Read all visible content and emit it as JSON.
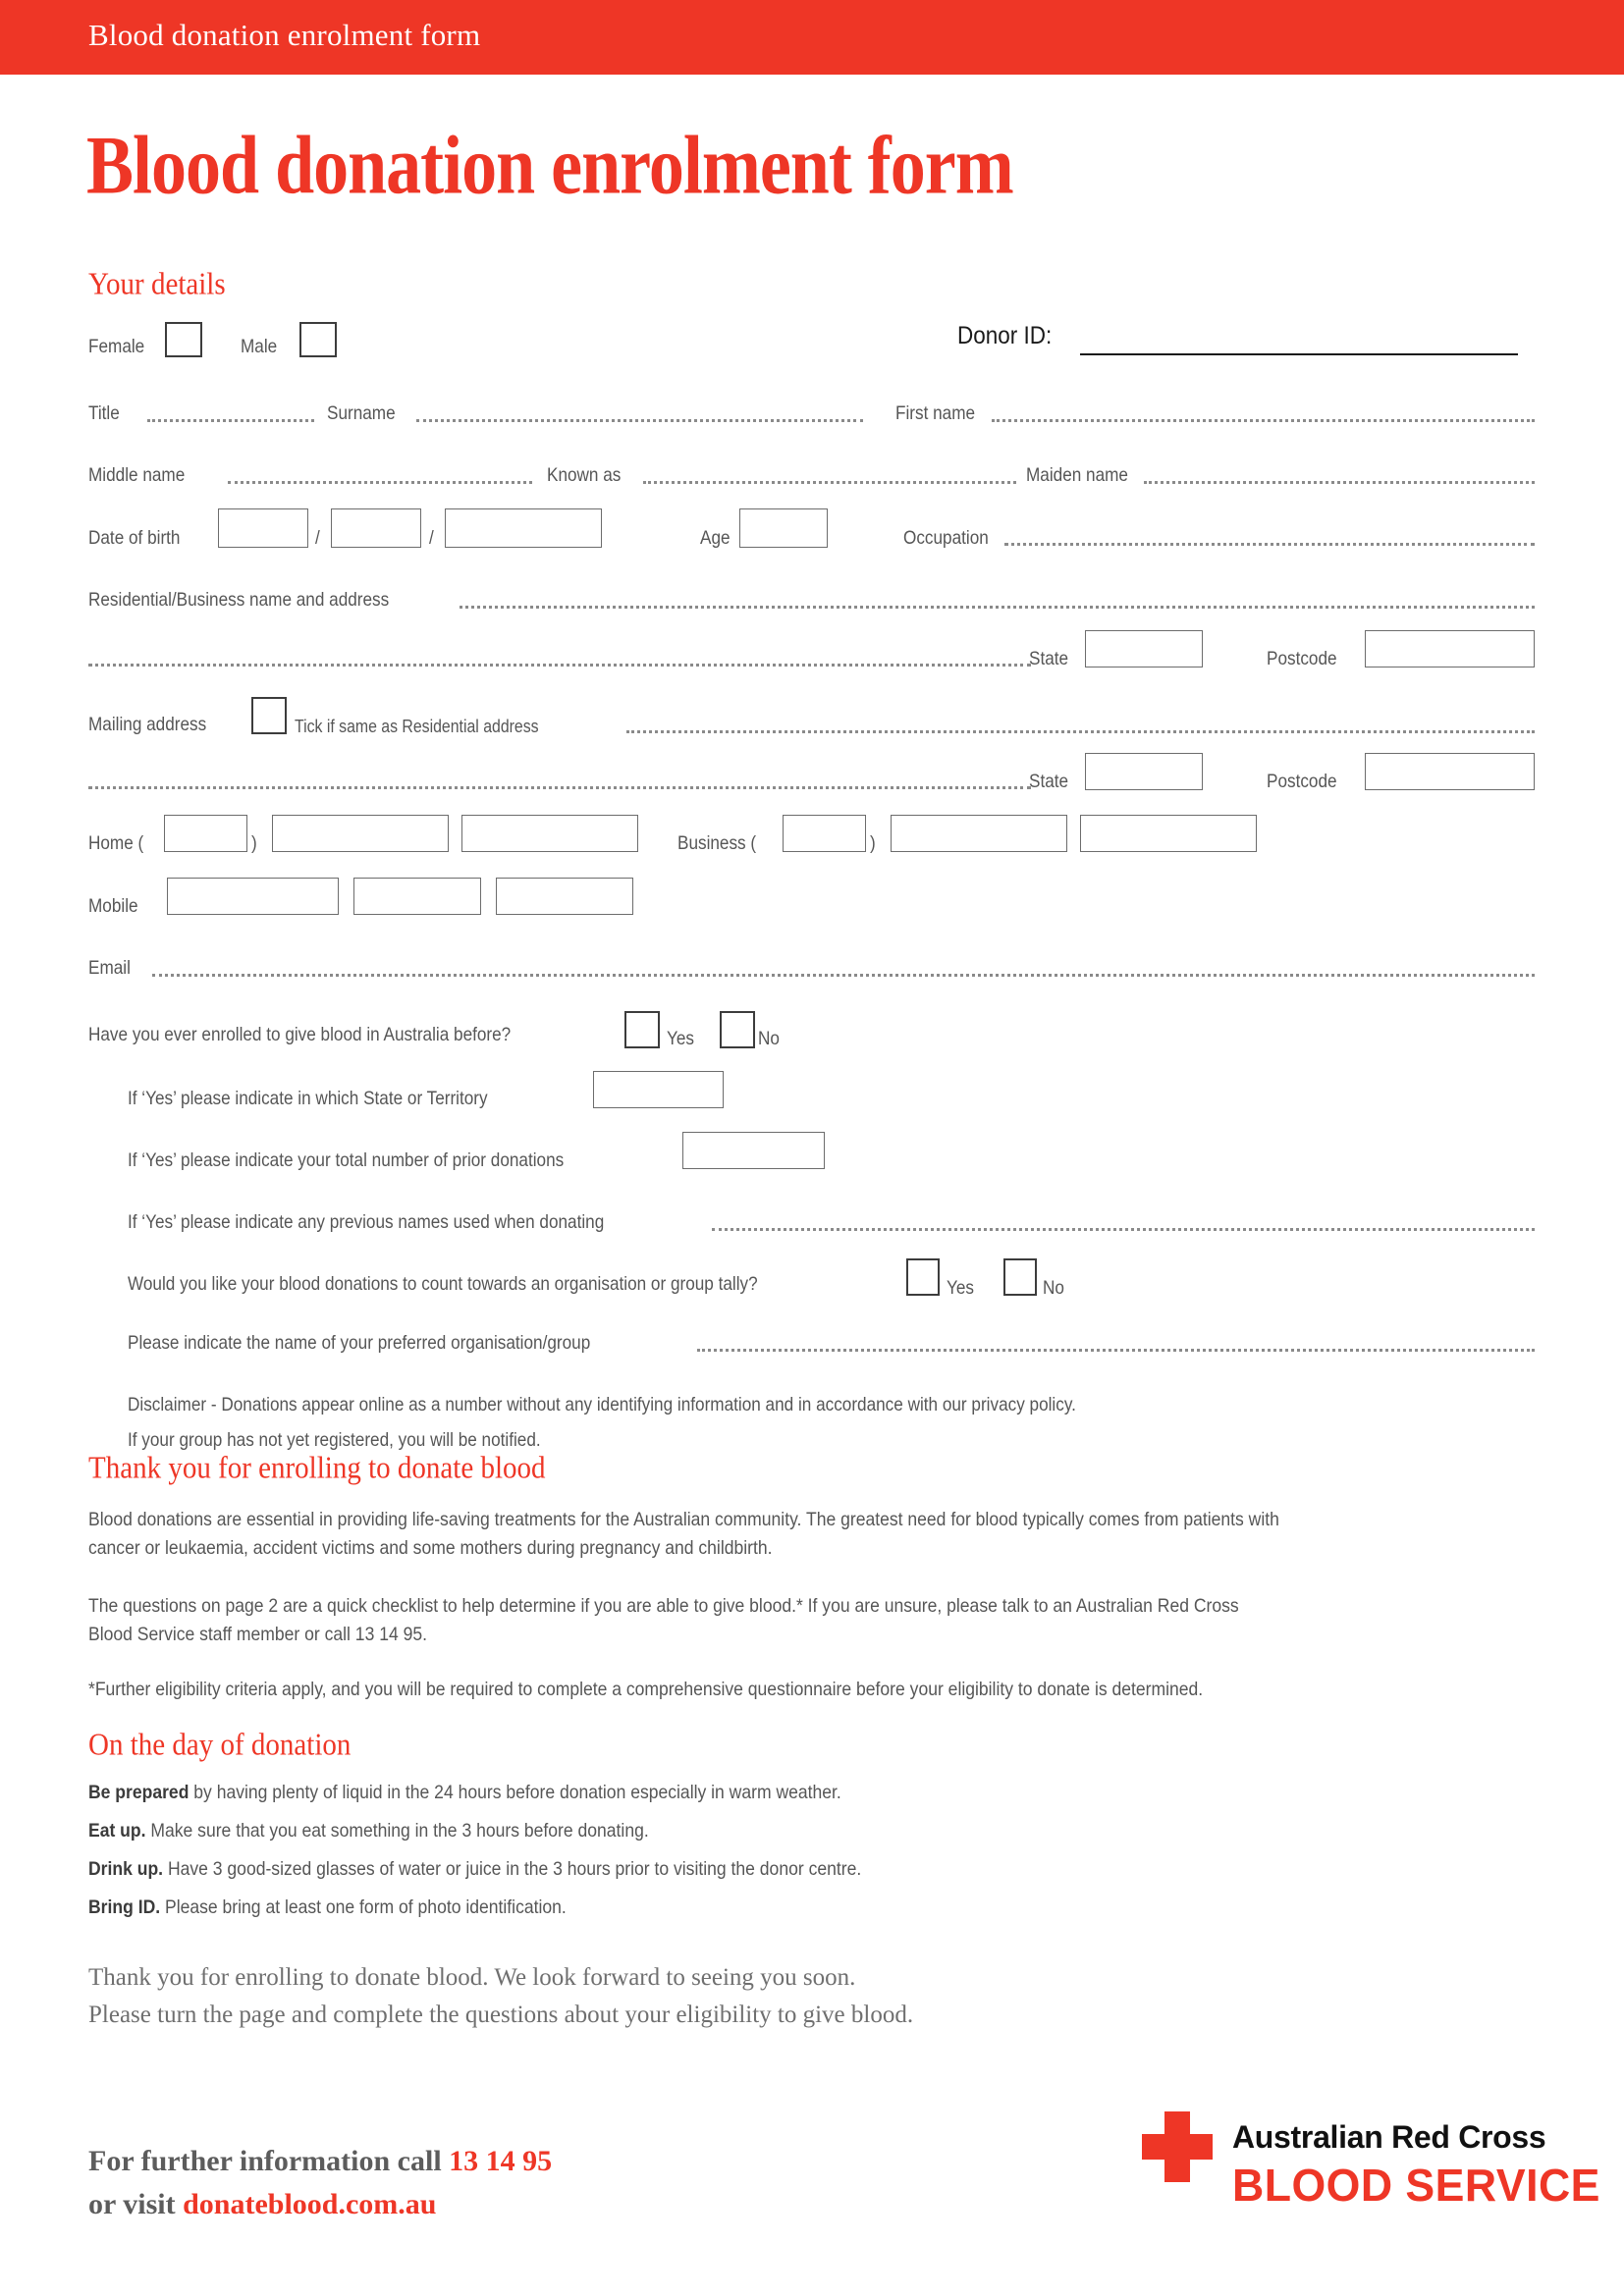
{
  "header": {
    "bar_title": "Blood donation enrolment form",
    "page_title": "Blood donation enrolment form",
    "bar_color": "#ee3626"
  },
  "your_details": {
    "heading": "Your details",
    "gender": {
      "female_label": "Female",
      "male_label": "Male"
    },
    "donor_id_label": "Donor ID:",
    "donor_id_value": "",
    "fields": {
      "title": "Title",
      "surname": "Surname",
      "first_name": "First name",
      "middle_name": "Middle name",
      "known_as": "Known as",
      "maiden_name": "Maiden name",
      "date_of_birth": "Date of birth",
      "dob_sep1": "/",
      "dob_sep2": "/",
      "age": "Age",
      "occupation": "Occupation",
      "residential_address": "Residential/Business name and address",
      "state": "State",
      "postcode": "Postcode",
      "mailing_address": "Mailing address",
      "mailing_tick": "Tick if same as Residential address",
      "state2": "State",
      "postcode2": "Postcode",
      "home": "Home (",
      "home_close": ")",
      "business": "Business (",
      "business_close": ")",
      "mobile": "Mobile",
      "email": "Email"
    }
  },
  "enrolment_history": {
    "question": "Have you ever enrolled to give blood in Australia before?",
    "yes": "Yes",
    "no": "No",
    "sub1": "If ‘Yes’ please indicate in which State or Territory",
    "sub2": "If ‘Yes’ please indicate your total number of prior donations",
    "sub3": "If ‘Yes’ please indicate any previous names used when donating",
    "tally_question": "Would you like your blood donations to count towards an organisation or group tally?",
    "tally_yes": "Yes",
    "tally_no": "No",
    "preferred_group": "Please indicate the name of your preferred organisation/group",
    "disclaimer_line1": "Disclaimer - Donations appear online as a number without any identifying information and in accordance with our privacy policy.",
    "disclaimer_line2": "If your group has not yet registered, you will be notified."
  },
  "thankyou": {
    "heading": "Thank you for enrolling to donate blood",
    "para1_line1": "Blood donations are essential in providing life-saving treatments for the Australian community. The greatest need for blood typically comes from patients with",
    "para1_line2": "cancer or leukaemia, accident victims and some mothers during pregnancy and childbirth.",
    "para2_line1": "The questions on page 2 are a quick checklist to help determine if you are able to give blood.* If you are unsure, please talk to an Australian Red Cross",
    "para2_line2": "Blood Service staff member or call 13 14 95.",
    "para3": "*Further eligibility criteria apply, and you will be required to complete a comprehensive questionnaire before your eligibility to donate is determined."
  },
  "on_the_day": {
    "heading": "On the day of donation",
    "items": [
      {
        "lead": "Be prepared",
        "text": " by having plenty of liquid in the 24 hours before donation especially in warm weather."
      },
      {
        "lead": "Eat up.",
        "text": " Make sure that you eat something in the 3 hours before donating."
      },
      {
        "lead": "Drink up.",
        "text": " Have 3 good-sized glasses of water or juice in the 3 hours prior to visiting the donor centre."
      },
      {
        "lead": "Bring ID.",
        "text": " Please bring at least one form of photo identification."
      }
    ],
    "closing_line1": "Thank you for enrolling to donate blood. We look forward to seeing you soon.",
    "closing_line2": "Please turn the page and complete the questions about your eligibility to give blood."
  },
  "footer": {
    "line1_prefix": "For further information call ",
    "phone": "13 14 95",
    "line2_prefix": "or visit ",
    "website": "donateblood.com.au",
    "logo_line1": "Australian Red Cross",
    "logo_line2": "BLOOD SERVICE"
  }
}
